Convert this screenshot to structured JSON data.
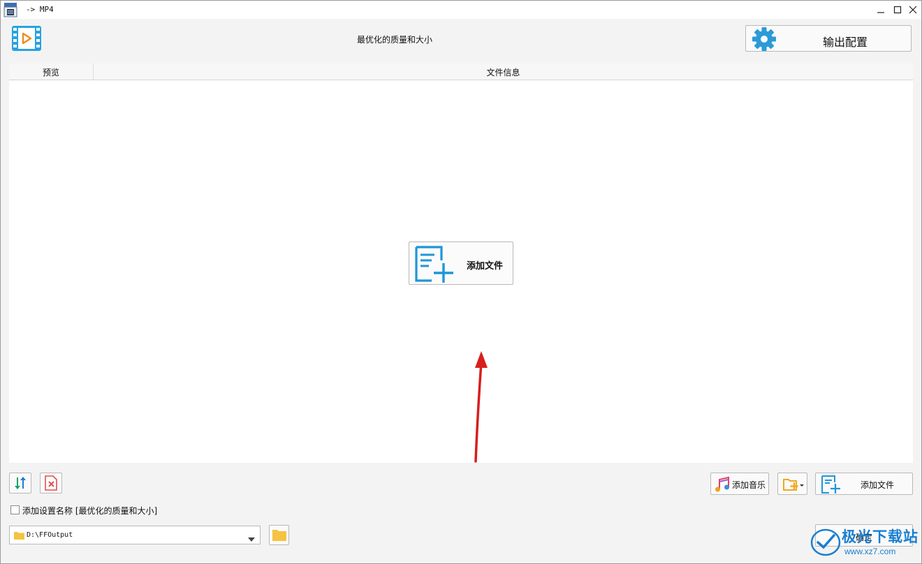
{
  "window": {
    "title": "-> MP4"
  },
  "header": {
    "title": "最优化的质量和大小",
    "output_settings_label": "输出配置"
  },
  "file_list": {
    "columns": [
      "预览",
      "文件信息"
    ],
    "add_file_center_label": "添加文件"
  },
  "toolbar": {
    "add_music_label": "添加音乐",
    "add_file_label": "添加文件"
  },
  "options": {
    "add_setting_name_label": "添加设置名称 [最优化的质量和大小]",
    "add_setting_name_checked": false
  },
  "output": {
    "path_value": "D:\\FFOutput",
    "ok_label": "确定"
  },
  "watermark": {
    "brand": "极光下载站",
    "url": "www.xz7.com"
  },
  "colors": {
    "accent_blue": "#1e96d8",
    "arrow_red": "#d81e1e",
    "folder_yellow": "#f5c342"
  }
}
